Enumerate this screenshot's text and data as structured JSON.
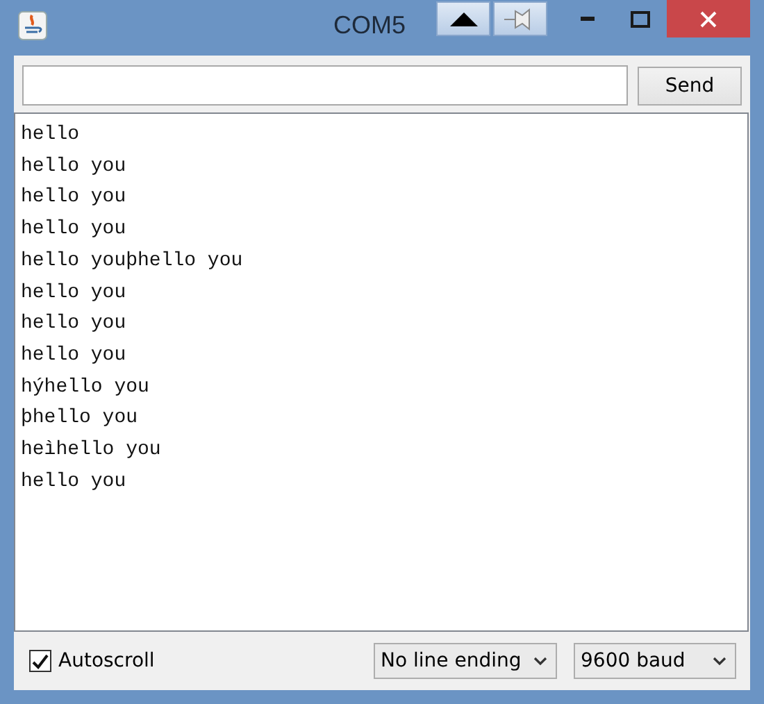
{
  "window": {
    "title": "COM5"
  },
  "send_bar": {
    "send_button": "Send"
  },
  "output_lines": [
    "hello",
    "hello you",
    "hello you",
    "hello you",
    "hello youþhello you",
    "hello you",
    "hello you",
    "hello you",
    "hýhello you",
    "þhello you",
    "heìhello you",
    "hello you"
  ],
  "footer": {
    "autoscroll": {
      "label": "Autoscroll",
      "checked": true
    },
    "line_ending": "No line ending",
    "baud_rate": "9600 baud"
  }
}
